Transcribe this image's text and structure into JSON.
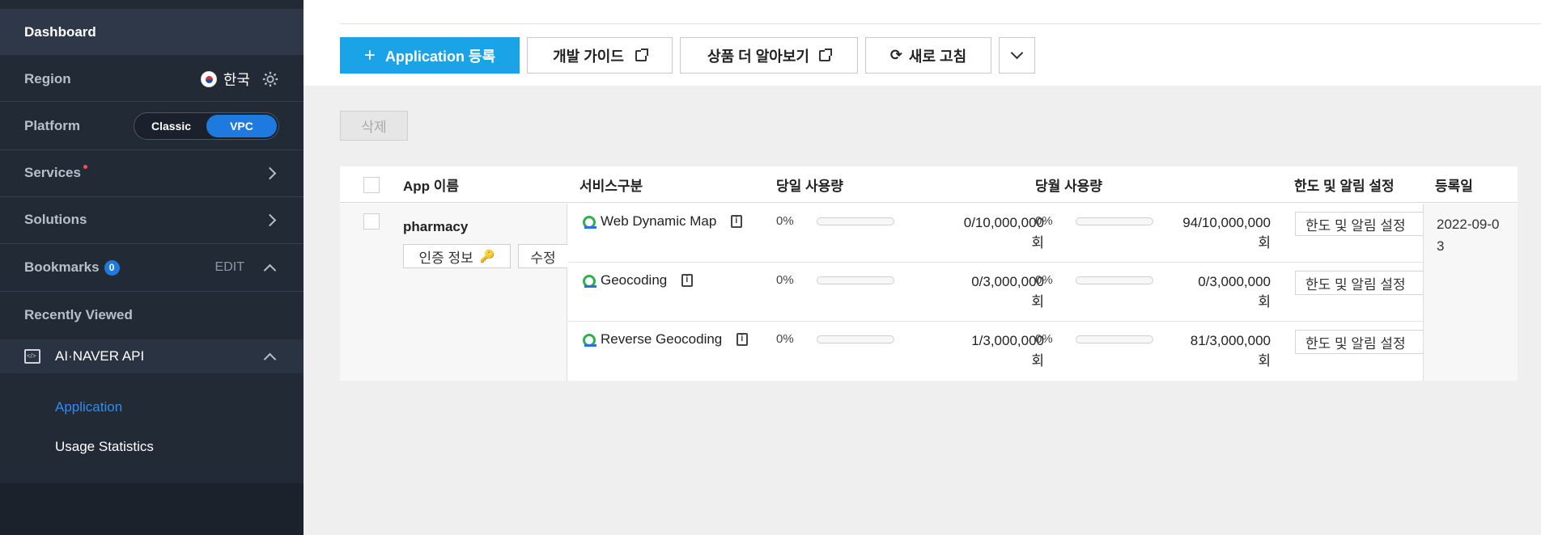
{
  "sidebar": {
    "dashboard": "Dashboard",
    "region_label": "Region",
    "region_value": "한국",
    "platform_label": "Platform",
    "platform_options": [
      "Classic",
      "VPC"
    ],
    "platform_selected": "VPC",
    "services_label": "Services",
    "solutions_label": "Solutions",
    "bookmarks_label": "Bookmarks",
    "bookmarks_count": "0",
    "bookmarks_edit": "EDIT",
    "recently_viewed": "Recently Viewed",
    "api_section": "AI·NAVER API",
    "sub_items": [
      "Application",
      "Usage Statistics"
    ],
    "active_sub": "Application",
    "colors": {
      "background": "#222a36",
      "active_link": "#2f8cf0",
      "accent": "#1f7ae0"
    }
  },
  "toolbar": {
    "add_app": "Application 등록",
    "dev_guide": "개발 가이드",
    "product_more": "상품 더 알아보기",
    "refresh": "새로 고침"
  },
  "actions": {
    "delete": "삭제"
  },
  "table": {
    "headers": [
      "App 이름",
      "서비스구분",
      "당일 사용량",
      "당월 사용량",
      "한도 및 알림 설정",
      "등록일"
    ],
    "app": {
      "name": "pharmacy",
      "auth_button": "인증 정보",
      "edit_button": "수정",
      "registered": "2022-09-03"
    },
    "rows": [
      {
        "service": "Web Dynamic Map",
        "daily_pct": "0%",
        "daily_usage": "0/10,000,000",
        "daily_unit": "회",
        "monthly_pct": "0%",
        "monthly_usage": "94/10,000,000",
        "monthly_unit": "회",
        "limit_label": "한도 및 알림 설정"
      },
      {
        "service": "Geocoding",
        "daily_pct": "0%",
        "daily_usage": "0/3,000,000",
        "daily_unit": "회",
        "monthly_pct": "0%",
        "monthly_usage": "0/3,000,000",
        "monthly_unit": "회",
        "limit_label": "한도 및 알림 설정"
      },
      {
        "service": "Reverse Geocoding",
        "daily_pct": "0%",
        "daily_usage": "1/3,000,000",
        "daily_unit": "회",
        "monthly_pct": "0%",
        "monthly_usage": "81/3,000,000",
        "monthly_unit": "회",
        "limit_label": "한도 및 알림 설정"
      }
    ]
  }
}
